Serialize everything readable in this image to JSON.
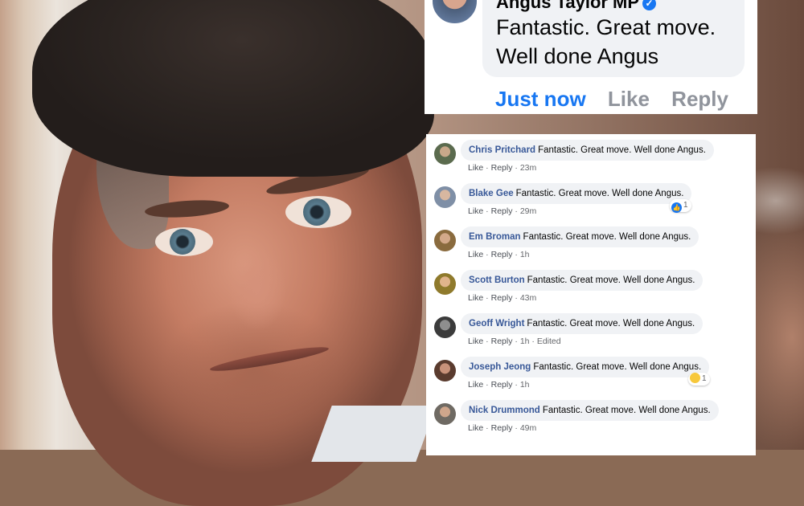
{
  "top_comment": {
    "author": "Angus Taylor MP",
    "text": "Fantastic. Great move. Well done Angus",
    "time": "Just now",
    "like_label": "Like",
    "reply_label": "Reply",
    "verified_icon": "verified-check-icon"
  },
  "comments": [
    {
      "name": "Chris Pritchard",
      "text": "Fantastic. Great move. Well done Angus.",
      "like": "Like",
      "reply": "Reply",
      "time": "23m",
      "avatar_color": "#5b6b4e"
    },
    {
      "name": "Blake Gee",
      "text": "Fantastic. Great move. Well done Angus.",
      "like": "Like",
      "reply": "Reply",
      "time": "29m",
      "reaction_count": "1",
      "reaction_icon": "like-reaction-icon",
      "avatar_color": "#7f8fa6"
    },
    {
      "name": "Em Broman",
      "text": "Fantastic. Great move. Well done Angus.",
      "like": "Like",
      "reply": "Reply",
      "time": "1h",
      "avatar_color": "#8a6b3e"
    },
    {
      "name": "Scott Burton",
      "text": "Fantastic. Great move. Well done Angus.",
      "like": "Like",
      "reply": "Reply",
      "time": "43m",
      "avatar_color": "#8f7a2c"
    },
    {
      "name": "Geoff Wright",
      "text": "Fantastic. Great move. Well done Angus.",
      "like": "Like",
      "reply": "Reply",
      "time": "1h",
      "edited": "Edited",
      "avatar_color": "#3b3b3b"
    },
    {
      "name": "Joseph Jeong",
      "text": "Fantastic. Great move. Well done Angus.",
      "like": "Like",
      "reply": "Reply",
      "time": "1h",
      "reaction_count": "1",
      "reaction_icon": "haha-reaction-icon",
      "avatar_color": "#5a3b2e"
    },
    {
      "name": "Nick Drummond",
      "text": "Fantastic. Great move. Well done Angus.",
      "like": "Like",
      "reply": "Reply",
      "time": "49m",
      "avatar_color": "#6f6a63"
    }
  ]
}
